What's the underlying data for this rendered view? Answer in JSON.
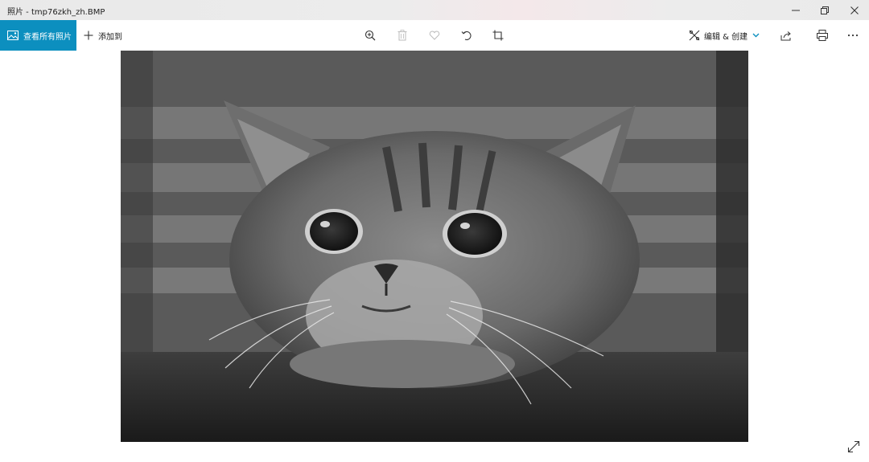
{
  "window": {
    "title": "照片 - tmp76zkh_zh.BMP",
    "minimize_icon": "minimize-icon",
    "maximize_icon": "restore-icon",
    "close_icon": "close-icon"
  },
  "toolbar": {
    "all_photos_label": "查看所有照片",
    "add_to_label": "添加到",
    "edit_create_label": "编辑 & 创建",
    "icons": [
      "zoom-in-icon",
      "delete-icon",
      "favorite-icon",
      "rotate-icon",
      "crop-icon",
      "share-icon",
      "print-icon",
      "more-icon"
    ]
  },
  "colors": {
    "accent": "#0c8fbf",
    "photo_tone": "grayscale"
  },
  "photo": {
    "subject": "grayscale cat resting chin on table"
  }
}
